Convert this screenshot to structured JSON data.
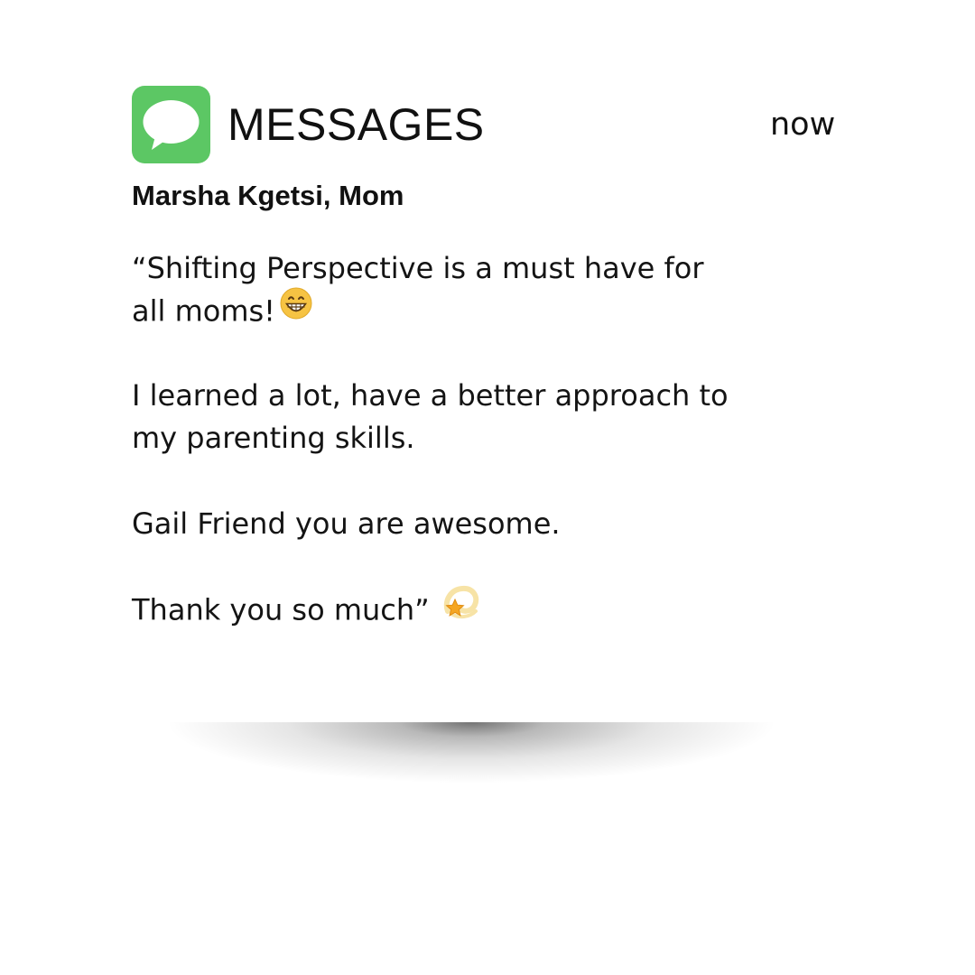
{
  "notification": {
    "app_name": "MESSAGES",
    "timestamp": "now",
    "app_icon": "speech-bubble-icon",
    "accent_color": "#5cc764",
    "sender": "Marsha Kgetsi, Mom",
    "message": {
      "paragraph1": {
        "line1": "“Shifting Perspective is a must have for",
        "line2": "all moms!",
        "emoji": "grinning-face-emoji"
      },
      "paragraph2": {
        "line1": "I learned a lot, have a better approach to",
        "line2": "my parenting skills."
      },
      "paragraph3": {
        "line1": "Gail Friend you are awesome."
      },
      "paragraph4": {
        "line1": "Thank you so much”",
        "emoji": "dizzy-star-emoji"
      }
    }
  }
}
